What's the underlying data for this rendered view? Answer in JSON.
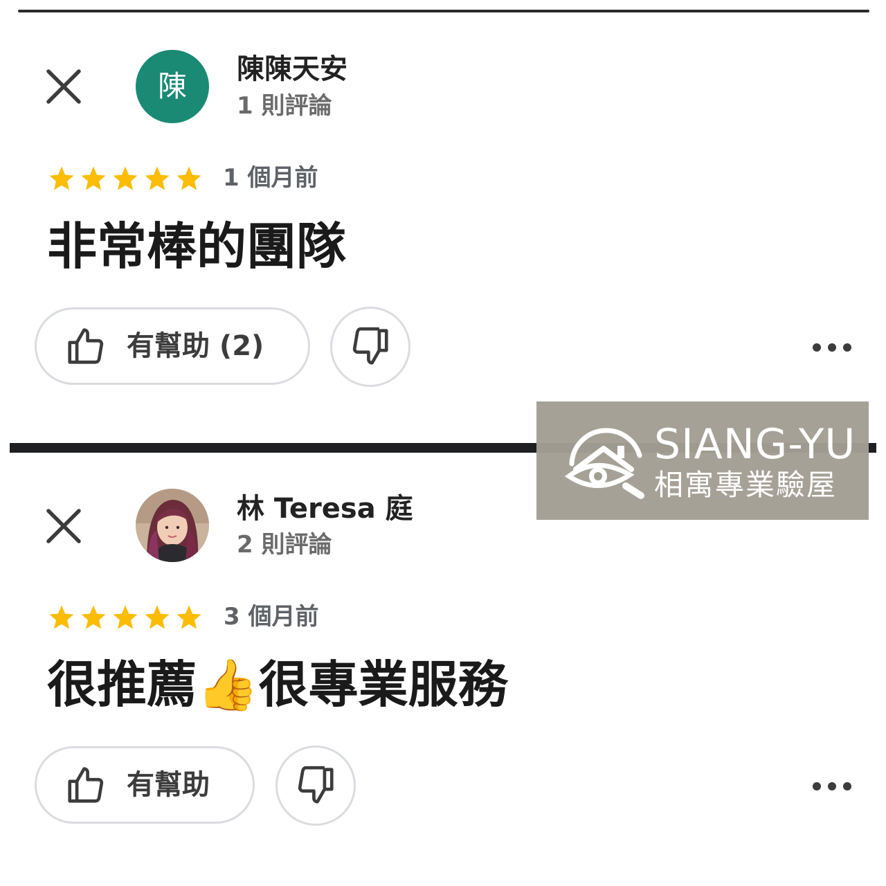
{
  "reviews": [
    {
      "avatar_initial": "陳",
      "avatar_color": "#1a8a74",
      "name": "陳陳天安",
      "review_count": "1 則評論",
      "rating": 5,
      "date": "1 個月前",
      "text": "非常棒的團隊",
      "helpful_label": "有幫助 (2)"
    },
    {
      "avatar_type": "photo",
      "name": "林 Teresa 庭",
      "review_count": "2 則評論",
      "rating": 5,
      "date": "3 個月前",
      "text": "很推薦👍很專業服務",
      "helpful_label": "有幫助"
    }
  ],
  "icons": {
    "close": "close-icon",
    "thumbs_up": "thumbs-up-icon",
    "thumbs_down": "thumbs-down-icon",
    "more": "more-horiz-icon",
    "star": "star-icon"
  },
  "colors": {
    "star": "#fbbc04",
    "avatar_teal": "#1a8a74",
    "watermark_bg": "#a39e94"
  },
  "watermark": {
    "title": "SIANG-YU",
    "subtitle": "相寓專業驗屋"
  }
}
